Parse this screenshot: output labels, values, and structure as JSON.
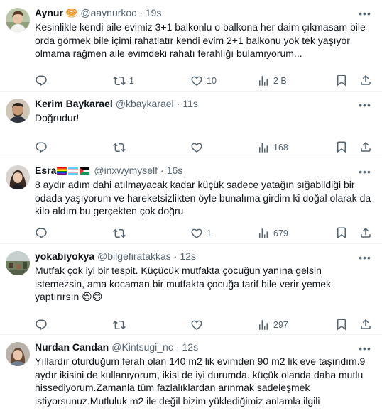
{
  "tweets": [
    {
      "name": "Aynur",
      "name_emoji": "🥯",
      "handle": "@aaynurkoc",
      "time": "19s",
      "text": "Kesinlikle kendi aile evimiz 3+1 balkonlu o balkona her daim çıkmasam bile orda görmek bile içimi rahatlatır kendi evim 2+1 balkonu yok tek yaşıyor olmama rağmen aile evimdeki rahatı ferahlığı bulamıyorum...",
      "replies": "",
      "retweets": "1",
      "likes": "10",
      "views": "2 B"
    },
    {
      "name": "Kerim Baykarael",
      "handle": "@kbaykarael",
      "time": "11s",
      "text": "Doğrudur!",
      "replies": "",
      "retweets": "",
      "likes": "",
      "views": "168"
    },
    {
      "name": "Esra",
      "handle": "@inxwymyself",
      "time": "16s",
      "text": "8 aydır adım dahi atılmayacak kadar küçük sadece yatağın sığabildiği bir odada yaşıyorum ve hareketsizlikten öyle bunalıma girdim ki doğal olarak da kilo aldım bu gerçekten çok doğru",
      "replies": "",
      "retweets": "",
      "likes": "1",
      "views": "679"
    },
    {
      "name": "yokabiyokya",
      "handle": "@bilgefiratakkas",
      "time": "12s",
      "text": "Mutfak çok iyi bir tespit. Küçücük mutfakta çocuğun yanına gelsin istemezsin, ama kocaman bir mutfakta çocuğa tarif bile verir yemek yaptırırsın 😌😄",
      "replies": "",
      "retweets": "",
      "likes": "",
      "views": "297"
    },
    {
      "name": "Nurdan Candan",
      "handle": "@Kintsugi_nc",
      "time": "12s",
      "text": "Yıllardır oturduğum ferah olan 140 m2 lik evimden 90 m2 lik eve taşındım.9 aydır ikisini de kullanıyorum, ikisi de iyi durumda. küçük olanda daha mutlu hissediyorum.Zamanla tüm fazlalıklardan arınmak sadeleşmek istiyorsunuz.Mutluluk m2 ile değil bizim yüklediğimiz anlamla ilgili"
    }
  ],
  "separator": "·",
  "colors": {
    "text": "#0f1419",
    "secondary": "#536471",
    "border": "#eff3f4"
  },
  "icons": {
    "reply": "reply-icon",
    "retweet": "retweet-icon",
    "like": "like-icon",
    "views": "views-icon",
    "bookmark": "bookmark-icon",
    "share": "share-icon",
    "more": "more-icon"
  }
}
